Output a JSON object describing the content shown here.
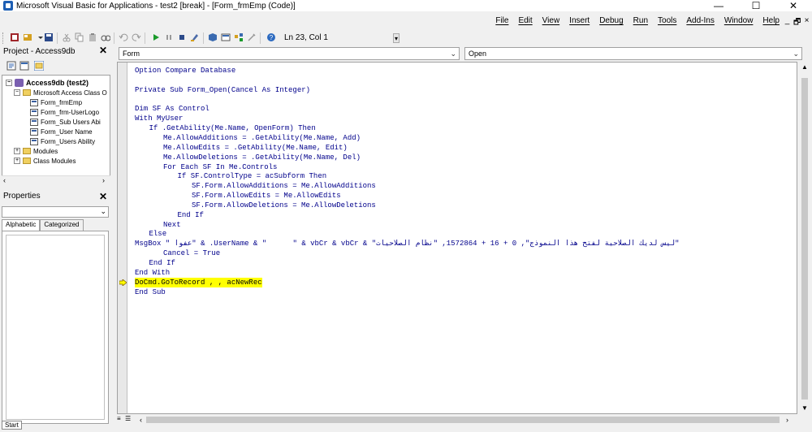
{
  "window": {
    "title": "Microsoft Visual Basic for Applications - test2 [break] - [Form_frmEmp (Code)]",
    "controls": [
      "—",
      "☐",
      "✕"
    ]
  },
  "menu": {
    "items": [
      "Help",
      "Window",
      "Add-Ins",
      "Tools",
      "Run",
      "Debug",
      "Insert",
      "View",
      "Edit",
      "File"
    ],
    "doc_controls": [
      "_",
      "🗗",
      "×"
    ]
  },
  "toolbar": {
    "position": "Ln 23, Col 1"
  },
  "project_panel": {
    "title": "Project - Access9db",
    "tree": [
      {
        "label": "Access9db (test2)",
        "level": 0,
        "kind": "project",
        "expander": "−"
      },
      {
        "label": "Microsoft Access Class O",
        "level": 1,
        "kind": "folder",
        "expander": "−"
      },
      {
        "label": "Form_frmEmp",
        "level": 2,
        "kind": "form"
      },
      {
        "label": "Form_frm-UserLogo",
        "level": 2,
        "kind": "form"
      },
      {
        "label": "Form_Sub Users Abi",
        "level": 2,
        "kind": "form"
      },
      {
        "label": "Form_User Name",
        "level": 2,
        "kind": "form"
      },
      {
        "label": "Form_Users Ability",
        "level": 2,
        "kind": "form"
      },
      {
        "label": "Modules",
        "level": 1,
        "kind": "folder",
        "expander": "+"
      },
      {
        "label": "Class Modules",
        "level": 1,
        "kind": "folder",
        "expander": "+"
      }
    ]
  },
  "properties_panel": {
    "title": "Properties",
    "tabs": [
      "Alphabetic",
      "Categorized"
    ]
  },
  "code_window": {
    "object_combo": "Form",
    "procedure_combo": "Open",
    "lines": [
      {
        "text": "Option Compare Database",
        "indent": 0
      },
      {
        "text": "",
        "indent": 0
      },
      {
        "text": "Private Sub Form_Open(Cancel As Integer)",
        "indent": 0
      },
      {
        "text": "",
        "indent": 0
      },
      {
        "text": "Dim SF As Control",
        "indent": 0
      },
      {
        "text": "With MyUser",
        "indent": 0
      },
      {
        "text": "If .GetAbility(Me.Name, OpenForm) Then",
        "indent": 1
      },
      {
        "text": "Me.AllowAdditions = .GetAbility(Me.Name, Add)",
        "indent": 2
      },
      {
        "text": "Me.AllowEdits = .GetAbility(Me.Name, Edit)",
        "indent": 2
      },
      {
        "text": "Me.AllowDeletions = .GetAbility(Me.Name, Del)",
        "indent": 2
      },
      {
        "text": "For Each SF In Me.Controls",
        "indent": 2
      },
      {
        "text": "If SF.ControlType = acSubform Then",
        "indent": 3
      },
      {
        "text": "SF.Form.AllowAdditions = Me.AllowAdditions",
        "indent": 4
      },
      {
        "text": "SF.Form.AllowEdits = Me.AllowEdits",
        "indent": 4
      },
      {
        "text": "SF.Form.AllowDeletions = Me.AllowDeletions",
        "indent": 4
      },
      {
        "text": "End If",
        "indent": 3
      },
      {
        "text": "Next",
        "indent": 2
      },
      {
        "text": "Else",
        "indent": 1
      },
      {
        "text": "MsgBox \" عفوا\" & .UserName & \"      \" & vbCr & vbCr & \"ليس لديك الصلاحية لفتح هذا النموذج\", 0 + 16 + 1572864, \"نظام الصلاحيات\"",
        "indent": 0
      },
      {
        "text": "Cancel = True",
        "indent": 2
      },
      {
        "text": "End If",
        "indent": 1
      },
      {
        "text": "End With",
        "indent": 0
      },
      {
        "text": "DoCmd.GoToRecord , , acNewRec",
        "indent": 0,
        "exec": true
      },
      {
        "text": "End Sub",
        "indent": 0
      }
    ]
  },
  "status": {
    "start_label": "Start"
  }
}
